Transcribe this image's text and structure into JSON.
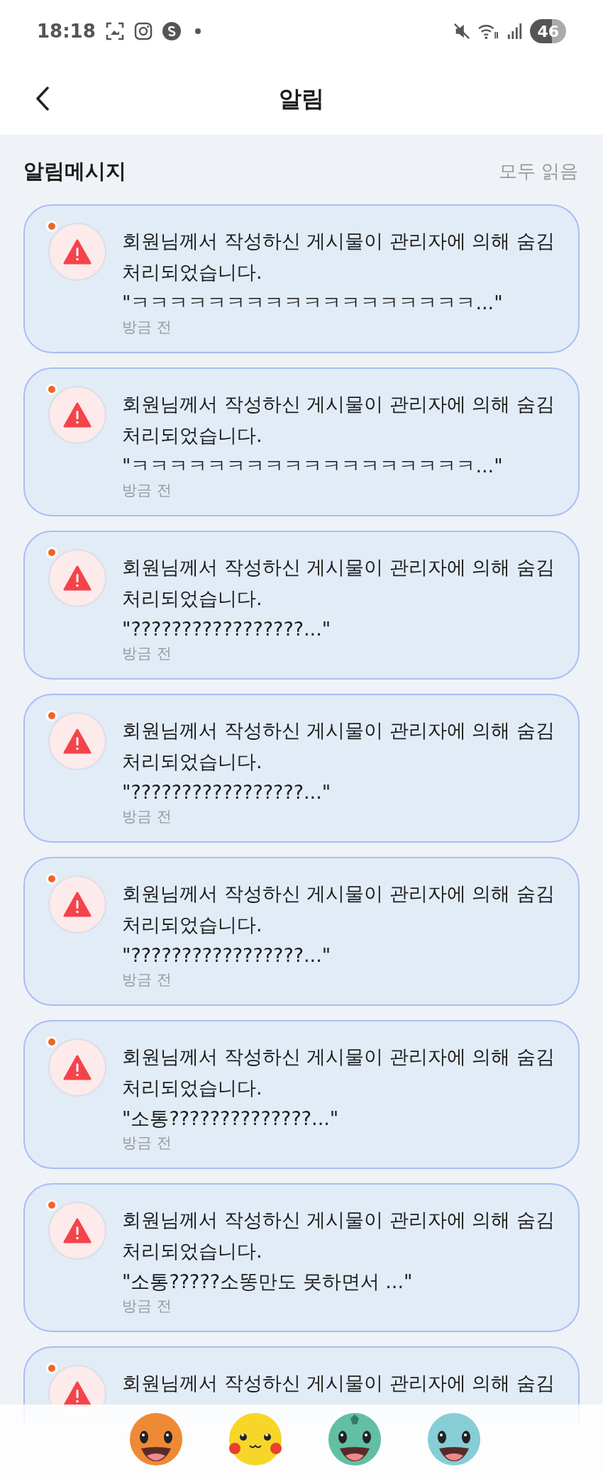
{
  "status_bar": {
    "time": "18:18",
    "battery": "46"
  },
  "header": {
    "title": "알림"
  },
  "section": {
    "title": "알림메시지",
    "action": "모두 읽음"
  },
  "notifications": [
    {
      "unread": true,
      "message": [
        "회원님께서 작성하신 게시물이 관리자에 의해 숨김",
        "처리되었습니다."
      ],
      "quote": "\"ㅋㅋㅋㅋㅋㅋㅋㅋㅋㅋㅋㅋㅋㅋㅋㅋㅋㅋ...\"",
      "time": "방금 전"
    },
    {
      "unread": true,
      "message": [
        "회원님께서 작성하신 게시물이 관리자에 의해 숨김",
        "처리되었습니다."
      ],
      "quote": "\"ㅋㅋㅋㅋㅋㅋㅋㅋㅋㅋㅋㅋㅋㅋㅋㅋㅋㅋ...\"",
      "time": "방금 전"
    },
    {
      "unread": true,
      "message": [
        "회원님께서 작성하신 게시물이 관리자에 의해 숨김",
        "처리되었습니다."
      ],
      "quote": "\"?????????????????...\"",
      "time": "방금 전"
    },
    {
      "unread": true,
      "message": [
        "회원님께서 작성하신 게시물이 관리자에 의해 숨김",
        "처리되었습니다."
      ],
      "quote": "\"?????????????????...\"",
      "time": "방금 전"
    },
    {
      "unread": true,
      "message": [
        "회원님께서 작성하신 게시물이 관리자에 의해 숨김",
        "처리되었습니다."
      ],
      "quote": "\"?????????????????...\"",
      "time": "방금 전"
    },
    {
      "unread": true,
      "message": [
        "회원님께서 작성하신 게시물이 관리자에 의해 숨김",
        "처리되었습니다."
      ],
      "quote": "\"소통??????????????...\"",
      "time": "방금 전"
    },
    {
      "unread": true,
      "message": [
        "회원님께서 작성하신 게시물이 관리자에 의해 숨김",
        "처리되었습니다."
      ],
      "quote": "\"소통?????소똥만도 못하면서 ...\"",
      "time": "방금 전"
    },
    {
      "unread": true,
      "message": [
        "회원님께서 작성하신 게시물이 관리자에 의해 숨김"
      ]
    }
  ],
  "bottom_nav": [
    {
      "kind": "lizard"
    },
    {
      "kind": "mouse"
    },
    {
      "kind": "frog"
    },
    {
      "kind": "turtle"
    }
  ]
}
